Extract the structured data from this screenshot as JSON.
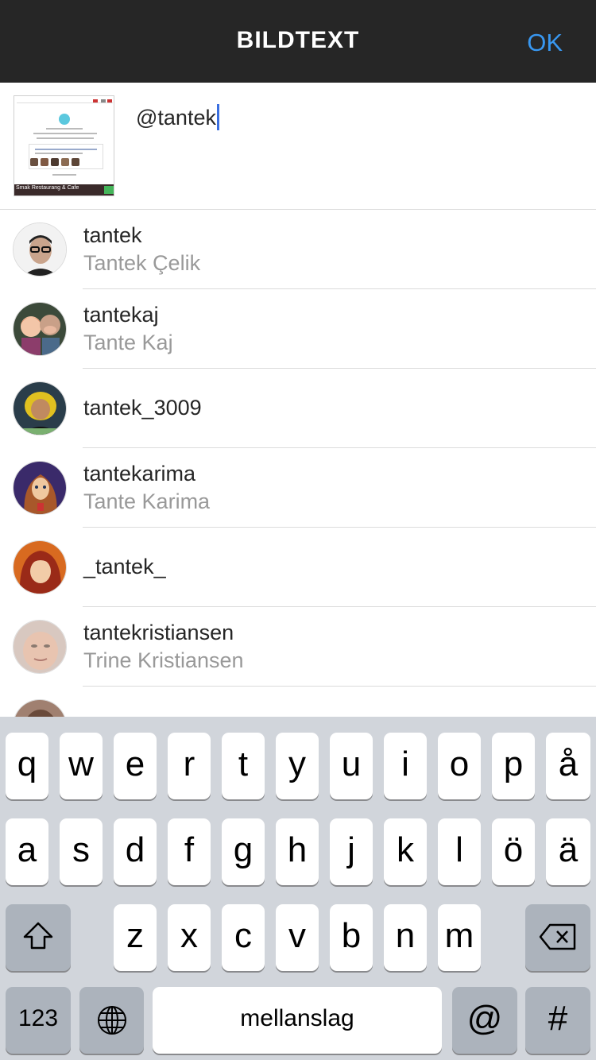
{
  "header": {
    "title": "BILDTEXT",
    "ok_label": "OK"
  },
  "caption": {
    "text": "@tantek",
    "thumbnail_strip_text": "Smak Restaurang & Cafe"
  },
  "suggestions": [
    {
      "username": "tantek",
      "fullname": "Tantek Çelik"
    },
    {
      "username": "tantekaj",
      "fullname": "Tante Kaj"
    },
    {
      "username": "tantek_3009",
      "fullname": ""
    },
    {
      "username": "tantekarima",
      "fullname": "Tante Karima"
    },
    {
      "username": "_tantek_",
      "fullname": ""
    },
    {
      "username": "tantekristiansen",
      "fullname": "Trine Kristiansen"
    },
    {
      "username": "",
      "fullname": ""
    }
  ],
  "keyboard": {
    "row1": [
      "q",
      "w",
      "e",
      "r",
      "t",
      "y",
      "u",
      "i",
      "o",
      "p",
      "å"
    ],
    "row2": [
      "a",
      "s",
      "d",
      "f",
      "g",
      "h",
      "j",
      "k",
      "l",
      "ö",
      "ä"
    ],
    "row3": [
      "z",
      "x",
      "c",
      "v",
      "b",
      "n",
      "m"
    ],
    "numbers_label": "123",
    "space_label": "mellanslag",
    "at_label": "@",
    "hash_label": "#",
    "shift_icon": "shift-arrow-icon",
    "delete_icon": "backspace-icon",
    "globe_icon": "globe-icon"
  },
  "colors": {
    "accent": "#3897f0",
    "header_bg": "#262626",
    "keyboard_bg": "#d1d5db"
  }
}
